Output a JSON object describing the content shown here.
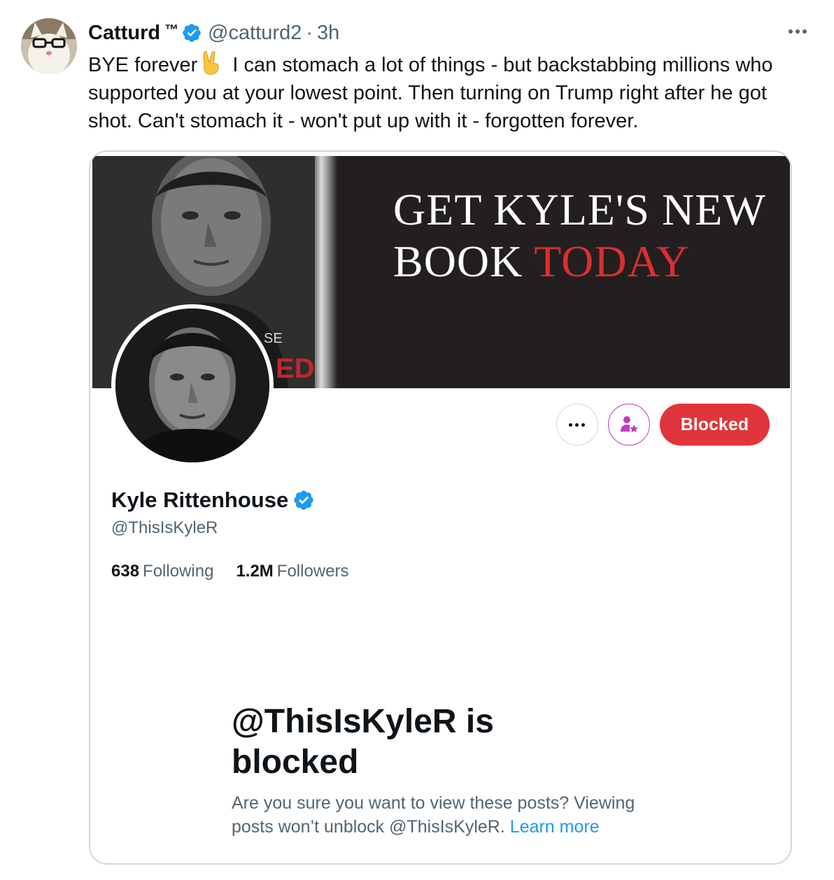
{
  "tweet": {
    "author_name": "Catturd",
    "author_badge": "™",
    "handle": "@catturd2",
    "separator": "·",
    "time": "3h",
    "text_part1": "BYE forever",
    "text_part2": "I can stomach a lot of things - but backstabbing millions who supported you at your lowest point. Then turning on Trump right after he got shot. Can't stomach it - won't put up with it - forgotten forever.",
    "emoji_icon": "victory-hand-icon"
  },
  "profile_card": {
    "banner": {
      "line1": "GET KYLE'S NEW",
      "line2_white": "BOOK",
      "line2_red": "TODAY",
      "book_fragment_top": "SE",
      "book_fragment_bottom": "ED"
    },
    "name": "Kyle Rittenhouse",
    "handle": "@ThisIsKyleR",
    "following_count": "638",
    "following_label": "Following",
    "followers_count": "1.2M",
    "followers_label": "Followers",
    "blocked_button": "Blocked",
    "blocked_title": "@ThisIsKyleR is blocked",
    "blocked_desc": "Are you sure you want to view these posts? Viewing posts won’t unblock @ThisIsKyleR.",
    "learn_more": "Learn more"
  },
  "colors": {
    "accent_blue": "#1d9bf0",
    "blocked_red": "#e0363b",
    "banner_red": "#d9302f",
    "subscribe_purple": "#c13bc1"
  }
}
